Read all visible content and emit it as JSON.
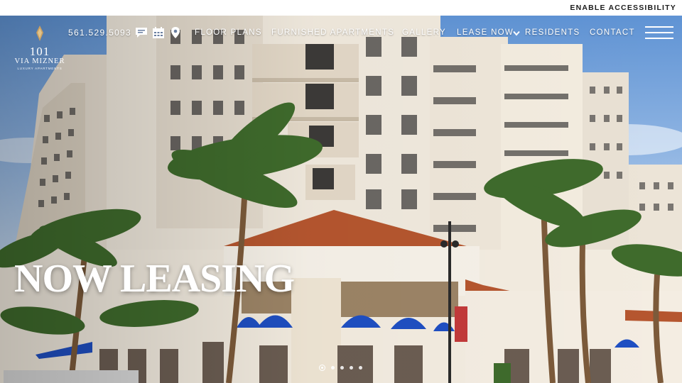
{
  "topbar": {
    "accessibility_label": "ENABLE ACCESSIBILITY"
  },
  "brand": {
    "number": "101",
    "name": "VIA MIZNER",
    "tagline": "LUXURY APARTMENTS"
  },
  "header": {
    "phone": "561.529.5093",
    "icons": [
      "chat-icon",
      "calendar-icon",
      "map-pin-icon"
    ],
    "nav": [
      {
        "label": "FLOOR PLANS"
      },
      {
        "label": "FURNISHED APARTMENTS"
      },
      {
        "label": "GALLERY"
      },
      {
        "label": "LEASE NOW",
        "has_dropdown": true
      },
      {
        "label": "RESIDENTS"
      },
      {
        "label": "CONTACT"
      }
    ],
    "menu_icon": "hamburger-menu-icon"
  },
  "hero": {
    "headline": "NOW LEASING",
    "slides_total": 5,
    "active_slide": 1
  },
  "colors": {
    "sky": "#7aa7dc",
    "building": "#efe7da",
    "roof_tile": "#b5562f",
    "awning": "#1f4fc2",
    "palm": "#3f6b2c",
    "text": "#ffffff"
  }
}
